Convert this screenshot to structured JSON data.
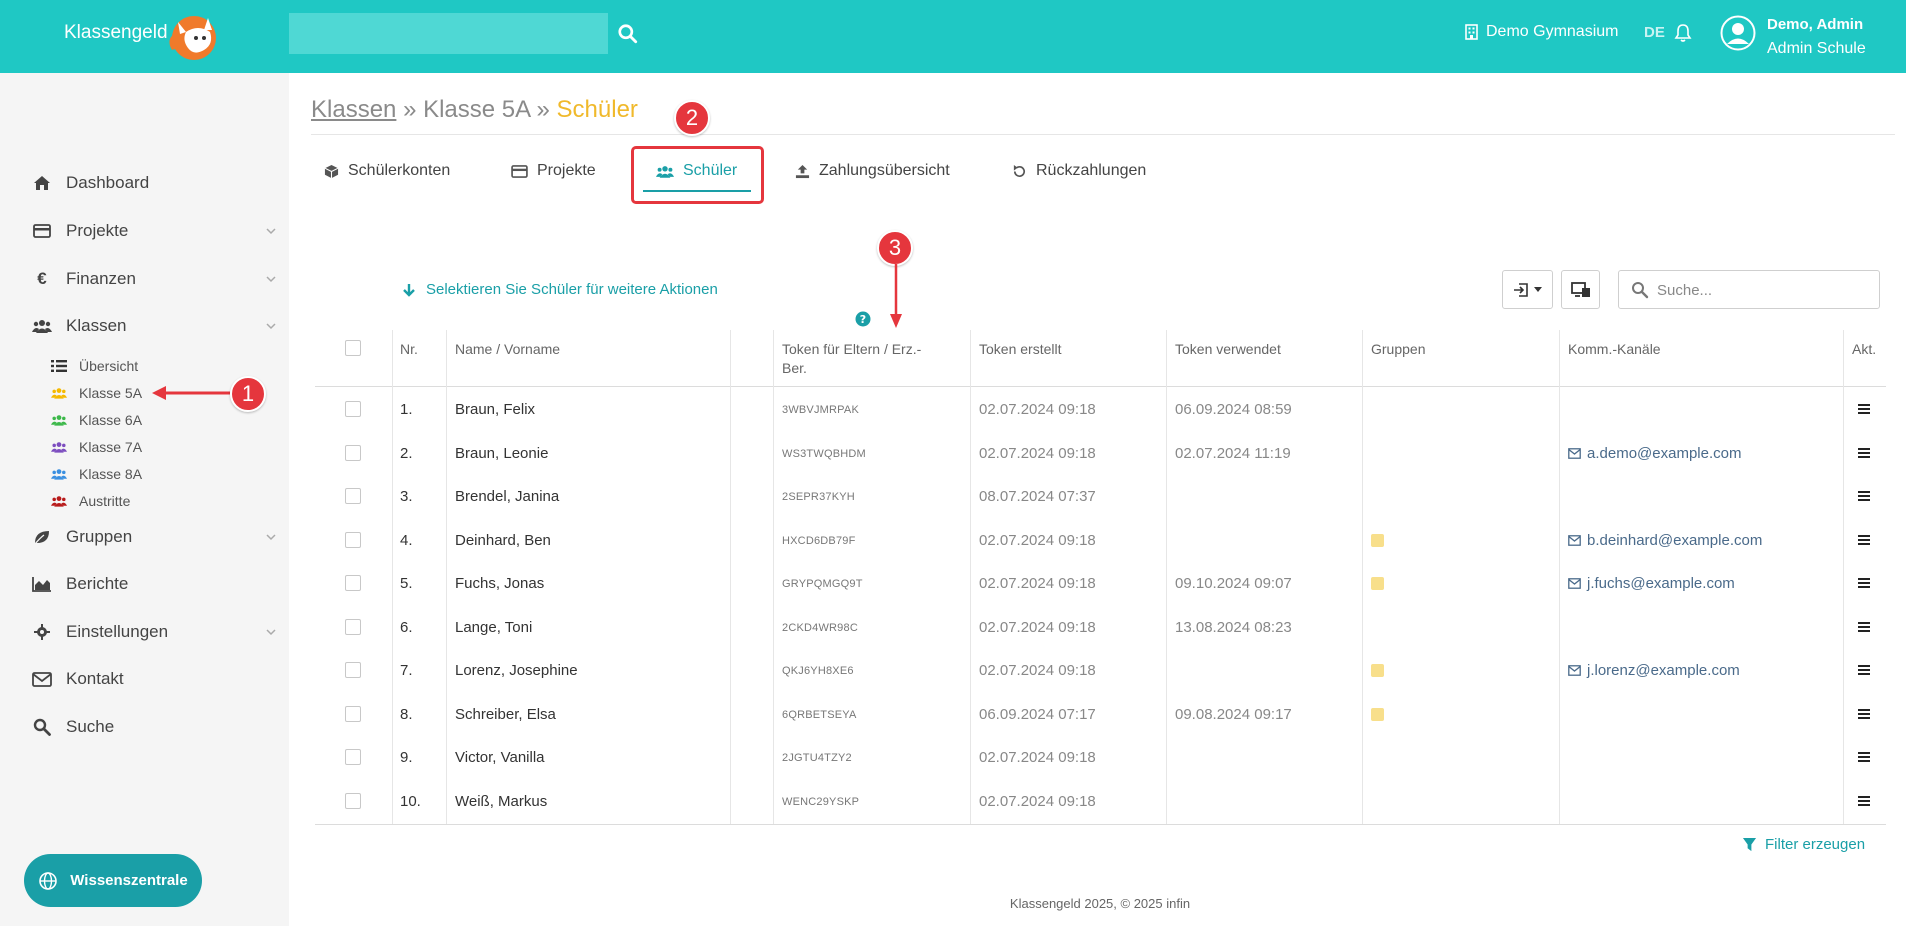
{
  "header": {
    "brand": "Klassengeld",
    "search_value": "",
    "school": "Demo Gymnasium",
    "language": "DE",
    "user_name": "Demo, Admin",
    "user_role": "Admin Schule"
  },
  "sidebar": {
    "items": [
      {
        "label": "Dashboard",
        "icon": "home-icon",
        "has_chevron": false
      },
      {
        "label": "Projekte",
        "icon": "credit-card-icon",
        "has_chevron": true
      },
      {
        "label": "Finanzen",
        "icon": "euro-icon",
        "has_chevron": true
      },
      {
        "label": "Klassen",
        "icon": "users-icon",
        "has_chevron": true
      },
      {
        "label": "Gruppen",
        "icon": "leaf-icon",
        "has_chevron": true
      },
      {
        "label": "Berichte",
        "icon": "area-chart-icon",
        "has_chevron": false
      },
      {
        "label": "Einstellungen",
        "icon": "gear-icon",
        "has_chevron": true
      },
      {
        "label": "Kontakt",
        "icon": "envelope-icon",
        "has_chevron": false
      },
      {
        "label": "Suche",
        "icon": "search-icon",
        "has_chevron": false
      }
    ],
    "sub_items": [
      {
        "label": "Übersicht",
        "color": "#333333",
        "icon": "list-icon"
      },
      {
        "label": "Klasse 5A",
        "color": "#f5b900",
        "icon": "users-icon"
      },
      {
        "label": "Klasse 6A",
        "color": "#3cb84a",
        "icon": "users-icon"
      },
      {
        "label": "Klasse 7A",
        "color": "#7c4dbf",
        "icon": "users-icon"
      },
      {
        "label": "Klasse 8A",
        "color": "#3a8fe0",
        "icon": "users-icon"
      },
      {
        "label": "Austritte",
        "color": "#b81a1a",
        "icon": "users-icon"
      }
    ],
    "wissen_label": "Wissenszentrale"
  },
  "breadcrumb": {
    "root": "Klassen",
    "sep": "»",
    "middle": "Klasse 5A",
    "current": "Schüler"
  },
  "tabs": [
    {
      "label": "Schülerkonten",
      "icon": "cube-icon"
    },
    {
      "label": "Projekte",
      "icon": "credit-card-icon"
    },
    {
      "label": "Schüler",
      "icon": "users-icon"
    },
    {
      "label": "Zahlungsübersicht",
      "icon": "upload-icon"
    },
    {
      "label": "Rückzahlungen",
      "icon": "undo-icon"
    }
  ],
  "annotations": {
    "one": "1",
    "two": "2",
    "three": "3"
  },
  "toolbar": {
    "select_hint": "Selektieren Sie Schüler für weitere Aktionen",
    "search_placeholder": "Suche..."
  },
  "table": {
    "headers": {
      "nr": "Nr.",
      "name": "Name / Vorname",
      "token_line1": "Token für Eltern / Erz.-",
      "token_line2": "Ber.",
      "created": "Token erstellt",
      "used": "Token verwendet",
      "groups": "Gruppen",
      "channels": "Komm.-Kanäle",
      "actions": "Akt."
    },
    "rows": [
      {
        "nr": "1.",
        "name": "Braun, Felix",
        "token": "3WBVJMRPAK",
        "created": "02.07.2024 09:18",
        "used": "06.09.2024 08:59",
        "group": false,
        "email": ""
      },
      {
        "nr": "2.",
        "name": "Braun, Leonie",
        "token": "WS3TWQBHDM",
        "created": "02.07.2024 09:18",
        "used": "02.07.2024 11:19",
        "group": false,
        "email": "a.demo@example.com"
      },
      {
        "nr": "3.",
        "name": "Brendel, Janina",
        "token": "2SEPR37KYH",
        "created": "08.07.2024 07:37",
        "used": "",
        "group": false,
        "email": ""
      },
      {
        "nr": "4.",
        "name": "Deinhard, Ben",
        "token": "HXCD6DB79F",
        "created": "02.07.2024 09:18",
        "used": "",
        "group": true,
        "email": "b.deinhard@example.com"
      },
      {
        "nr": "5.",
        "name": "Fuchs, Jonas",
        "token": "GRYPQMGQ9T",
        "created": "02.07.2024 09:18",
        "used": "09.10.2024 09:07",
        "group": true,
        "email": "j.fuchs@example.com"
      },
      {
        "nr": "6.",
        "name": "Lange, Toni",
        "token": "2CKD4WR98C",
        "created": "02.07.2024 09:18",
        "used": "13.08.2024 08:23",
        "group": false,
        "email": ""
      },
      {
        "nr": "7.",
        "name": "Lorenz, Josephine",
        "token": "QKJ6YH8XE6",
        "created": "02.07.2024 09:18",
        "used": "",
        "group": true,
        "email": "j.lorenz@example.com"
      },
      {
        "nr": "8.",
        "name": "Schreiber, Elsa",
        "token": "6QRBETSEYA",
        "created": "06.09.2024 07:17",
        "used": "09.08.2024 09:17",
        "group": true,
        "email": ""
      },
      {
        "nr": "9.",
        "name": "Victor, Vanilla",
        "token": "2JGTU4TZY2",
        "created": "02.07.2024 09:18",
        "used": "",
        "group": false,
        "email": ""
      },
      {
        "nr": "10.",
        "name": "Weiß, Markus",
        "token": "WENC29YSKP",
        "created": "02.07.2024 09:18",
        "used": "",
        "group": false,
        "email": ""
      }
    ]
  },
  "filter_label": "Filter erzeugen",
  "footer": "Klassengeld 2025, © 2025 infin",
  "colors": {
    "header_bg": "#1fc8c4",
    "accent": "#1a9fa7",
    "breadcrumb_current": "#f0b92b",
    "annotation_red": "#e5363d",
    "group_marker": "#f8df8b"
  }
}
